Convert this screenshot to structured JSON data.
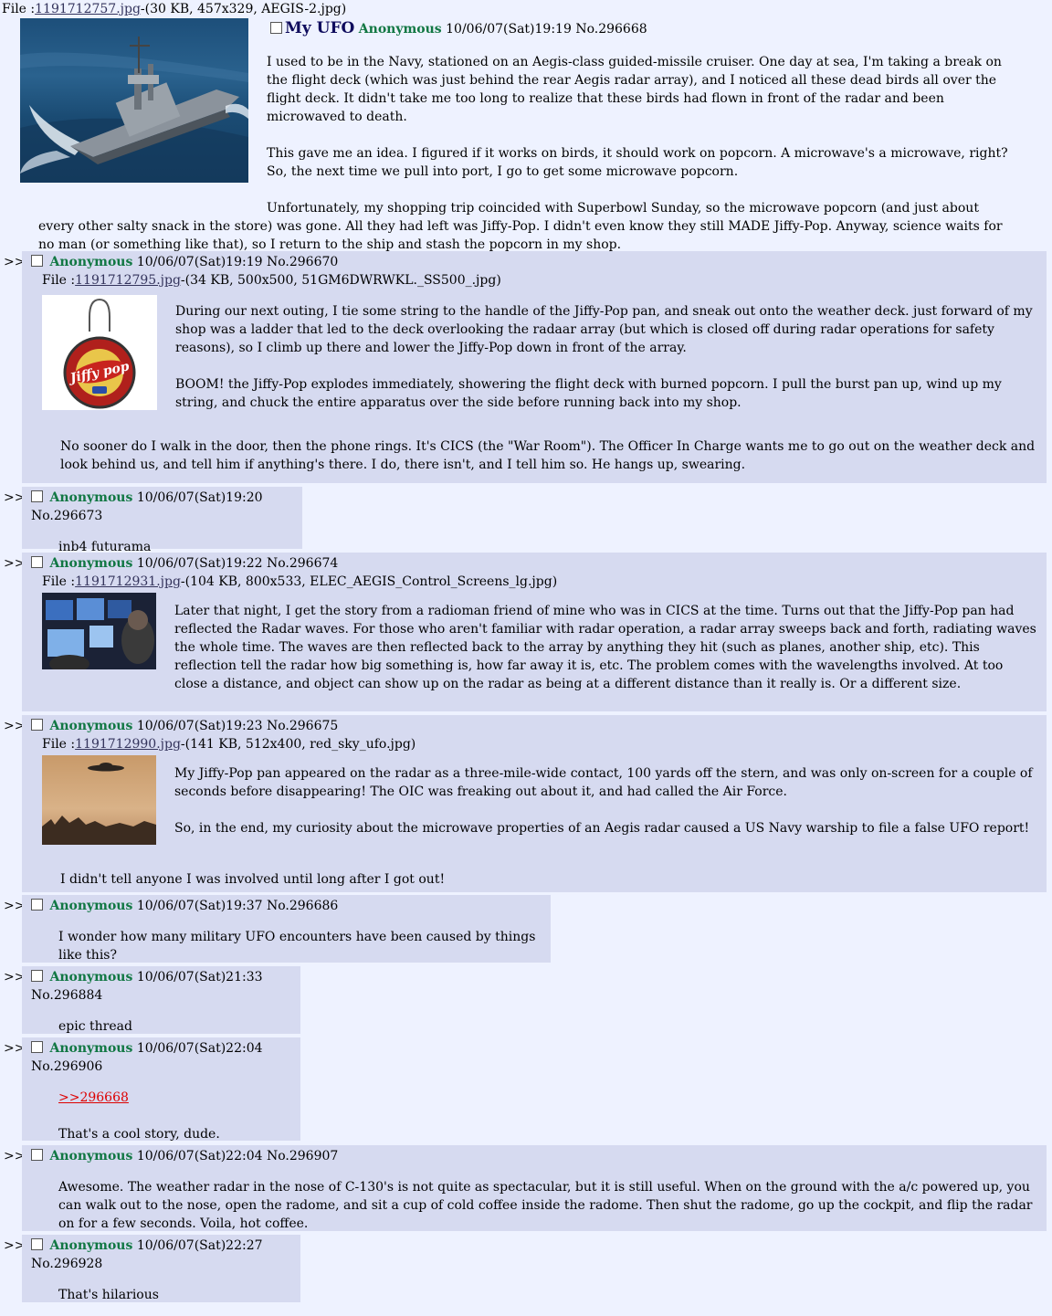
{
  "op": {
    "file_prefix": "File :",
    "file_link": "1191712757.jpg",
    "file_meta": "-(30 KB, 457x329, AEGIS-2.jpg)",
    "subject": "My UFO",
    "name": "Anonymous",
    "datetime": "10/06/07(Sat)19:19",
    "number": "No.296668",
    "paragraphs": [
      "I used to be in the Navy, stationed on an Aegis-class guided-missile cruiser. One day at sea, I'm taking a break on the flight deck (which was just behind the rear Aegis radar array), and I noticed all these dead birds all over the flight deck. It didn't take me too long to realize that these birds had flown in front of the radar and been microwaved to death.",
      "This gave me an idea. I figured if it works on birds, it should work on popcorn. A microwave's a microwave, right? So, the next time we pull into port, I go to get some microwave popcorn.",
      "Unfortunately, my shopping trip coincided with Superbowl Sunday, so the microwave popcorn (and just about every other salty snack in the store) was gone. All they had left was Jiffy-Pop. I didn't even know they still MADE Jiffy-Pop. Anyway, science waits for no man (or something like that), so I return to the ship and stash the popcorn in my shop."
    ]
  },
  "replies": [
    {
      "arrows": ">>",
      "name": "Anonymous",
      "datetime": "10/06/07(Sat)19:19",
      "number": "No.296670",
      "file_prefix": "File :",
      "file_link": "1191712795.jpg",
      "file_meta": "-(34 KB, 500x500, 51GM6DWRWKL._SS500_.jpg)",
      "thumb_text": "Jiffy pop",
      "paragraphs": [
        "During our next outing, I tie some string to the handle of the Jiffy-Pop pan, and sneak out onto the weather deck. just forward of my shop was a ladder that led to the deck overlooking the radaar array (but which is closed off during radar operations for safety reasons), so I climb up there and lower the Jiffy-Pop down in front of the array.",
        "BOOM! the Jiffy-Pop explodes immediately, showering the flight deck with burned popcorn. I pull the burst pan up, wind up my string, and chuck the entire apparatus over the side before running back into my shop."
      ],
      "after": [
        "No sooner do I walk in the door, then the phone rings. It's CICS (the \"War Room\"). The Officer In Charge wants me to go out on the weather deck and look behind us, and tell him if anything's there. I do, there isn't, and I tell him so. He hangs up, swearing."
      ]
    },
    {
      "arrows": ">>",
      "name": "Anonymous",
      "datetime": "10/06/07(Sat)19:20",
      "number": "No.296673",
      "paragraphs": [
        "inb4 futurama"
      ]
    },
    {
      "arrows": ">>",
      "name": "Anonymous",
      "datetime": "10/06/07(Sat)19:22",
      "number": "No.296674",
      "file_prefix": "File :",
      "file_link": "1191712931.jpg",
      "file_meta": "-(104 KB, 800x533, ELEC_AEGIS_Control_Screens_lg.jpg)",
      "paragraphs": [
        "Later that night, I get the story from a radioman friend of mine who was in CICS at the time. Turns out that the Jiffy-Pop pan had reflected the Radar waves. For those who aren't familiar with radar operation, a radar array sweeps back and forth, radiating waves the whole time. The waves are then reflected back to the array by anything they hit (such as planes, another ship, etc). This reflection tell the radar how big something is, how far away it is, etc. The problem comes with the wavelengths involved. At too close a distance, and object can show up on the radar as being at a different distance than it really is. Or a different size."
      ]
    },
    {
      "arrows": ">>",
      "name": "Anonymous",
      "datetime": "10/06/07(Sat)19:23",
      "number": "No.296675",
      "file_prefix": "File :",
      "file_link": "1191712990.jpg",
      "file_meta": "-(141 KB, 512x400, red_sky_ufo.jpg)",
      "paragraphs": [
        "My Jiffy-Pop pan appeared on the radar as a three-mile-wide contact, 100 yards off the stern, and was only on-screen for a couple of seconds before disappearing! The OIC was freaking out about it, and had called the Air Force.",
        "So, in the end, my curiosity about the microwave properties of an Aegis radar caused a US Navy warship to file a false UFO report!"
      ],
      "after": [
        "I didn't tell anyone I was involved until long after I got out!"
      ]
    },
    {
      "arrows": ">>",
      "name": "Anonymous",
      "datetime": "10/06/07(Sat)19:37",
      "number": "No.296686",
      "paragraphs": [
        "I wonder how many military UFO encounters have been caused by things like this?"
      ]
    },
    {
      "arrows": ">>",
      "name": "Anonymous",
      "datetime": "10/06/07(Sat)21:33",
      "number": "No.296884",
      "paragraphs": [
        "epic thread"
      ]
    },
    {
      "arrows": ">>",
      "name": "Anonymous",
      "datetime": "10/06/07(Sat)22:04",
      "number": "No.296906",
      "quote_link": ">>296668",
      "paragraphs": [
        "That's a cool story, dude."
      ]
    },
    {
      "arrows": ">>",
      "name": "Anonymous",
      "datetime": "10/06/07(Sat)22:04",
      "number": "No.296907",
      "paragraphs": [
        "Awesome. The weather radar in the nose of C-130's is not quite as spectacular, but it is still useful. When on the ground with the a/c powered up, you can walk out to the nose, open the radome, and sit a cup of cold coffee inside the radome. Then shut the radome, go up the cockpit, and flip the radar on for a few seconds. Voila, hot coffee."
      ]
    },
    {
      "arrows": ">>",
      "name": "Anonymous",
      "datetime": "10/06/07(Sat)22:27",
      "number": "No.296928",
      "paragraphs": [
        "That's hilarious"
      ]
    }
  ]
}
